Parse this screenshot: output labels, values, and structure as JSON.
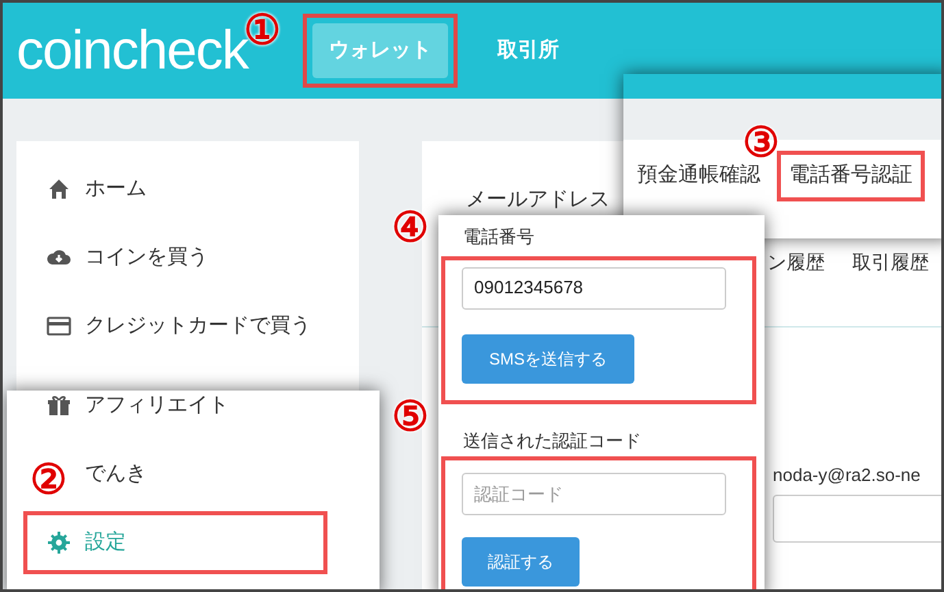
{
  "header": {
    "logo": "coincheck",
    "nav": [
      {
        "label": "ウォレット",
        "selected": true
      },
      {
        "label": "取引所",
        "selected": false
      }
    ]
  },
  "sidebar": {
    "items": [
      {
        "label": "ホーム",
        "kind": "home"
      },
      {
        "label": "コインを買う",
        "kind": "buy"
      },
      {
        "label": "クレジットカードで買う",
        "kind": "card"
      }
    ]
  },
  "sidebar_overlay": {
    "items": [
      {
        "label": "アフィリエイト",
        "kind": "gift",
        "selected": false
      },
      {
        "label": "でんき",
        "kind": "none",
        "selected": false
      },
      {
        "label": "設定",
        "kind": "gear",
        "selected": true
      }
    ]
  },
  "main": {
    "tab_partial": "メールアドレス",
    "subtabs": [
      "ン履歴",
      "取引履歴"
    ],
    "email": "noda-y@ra2.so-ne"
  },
  "tabs_overlay": [
    {
      "label": "預金通帳確認",
      "selected": false
    },
    {
      "label": "電話番号認証",
      "selected": true
    }
  ],
  "phone_form": {
    "phone_label": "電話番号",
    "phone_value": "09012345678",
    "sms_button": "SMSを送信する",
    "code_label": "送信された認証コード",
    "code_placeholder": "認証コード",
    "verify_button": "認証する"
  },
  "markers": [
    "①",
    "②",
    "③",
    "④",
    "⑤"
  ]
}
